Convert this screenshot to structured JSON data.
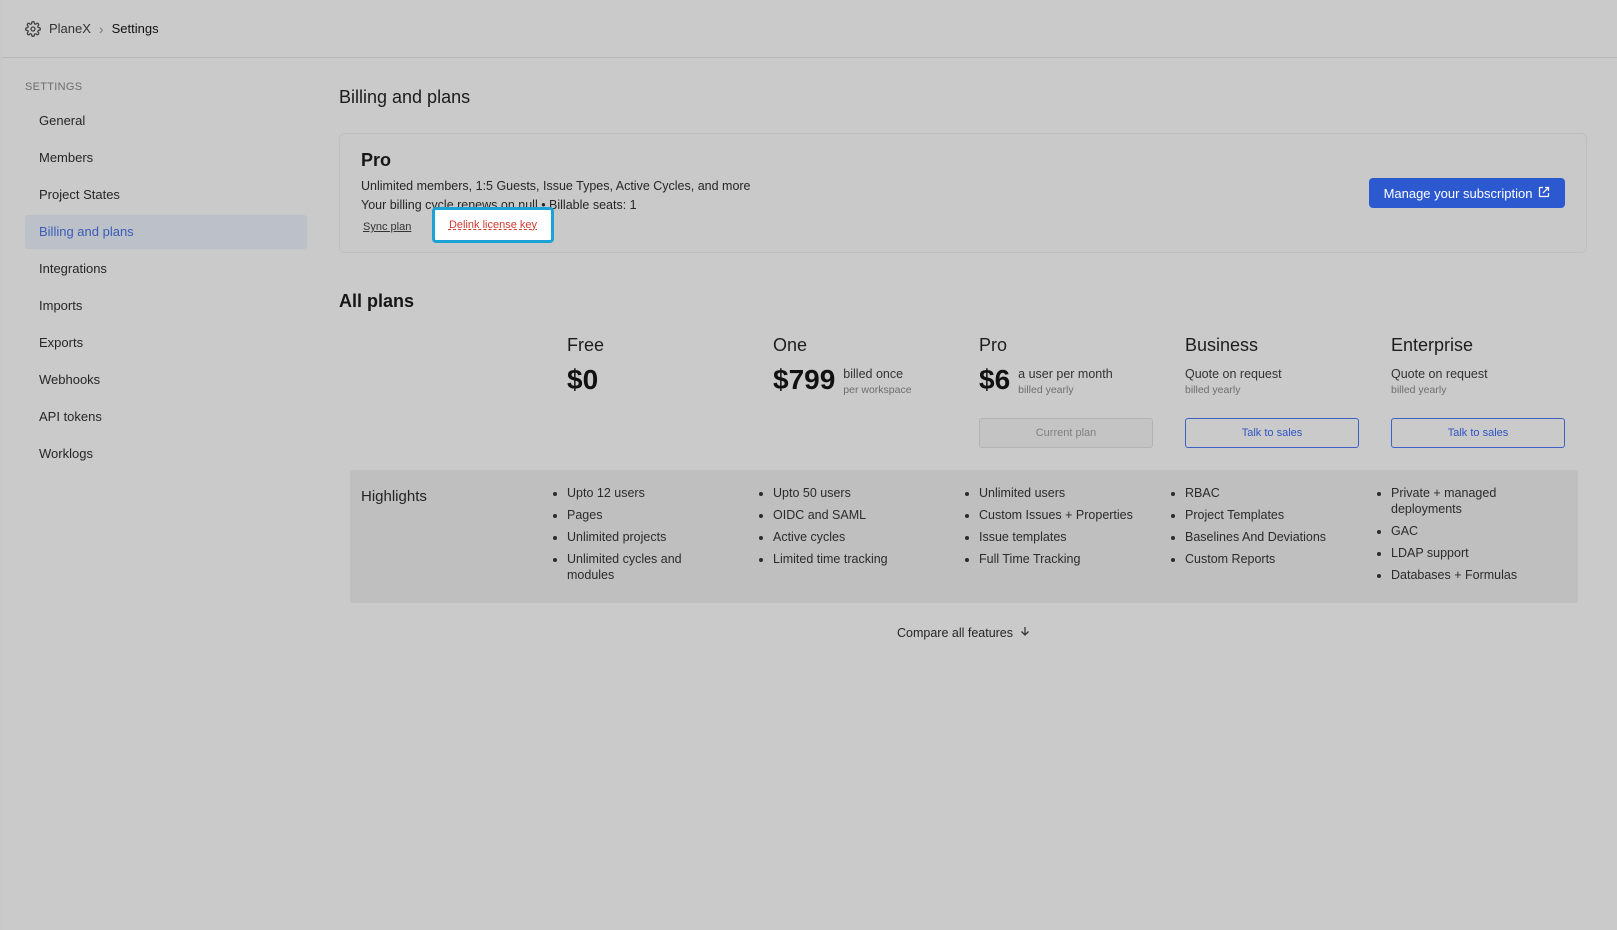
{
  "breadcrumb": {
    "workspace": "PlaneX",
    "page": "Settings"
  },
  "sidebar": {
    "section_label": "SETTINGS",
    "items": [
      {
        "label": "General"
      },
      {
        "label": "Members"
      },
      {
        "label": "Project States"
      },
      {
        "label": "Billing and plans",
        "active": true
      },
      {
        "label": "Integrations"
      },
      {
        "label": "Imports"
      },
      {
        "label": "Exports"
      },
      {
        "label": "Webhooks"
      },
      {
        "label": "API tokens"
      },
      {
        "label": "Worklogs"
      }
    ]
  },
  "main": {
    "title": "Billing and plans",
    "current_plan": {
      "name": "Pro",
      "description": "Unlimited members, 1:5 Guests, Issue Types, Active Cycles, and more",
      "cycle": "Your billing cycle renews on null • Billable seats: 1",
      "sync_label": "Sync plan",
      "delink_label": "Delink license key",
      "manage_label": "Manage your subscription"
    },
    "all_plans_title": "All plans",
    "plans": [
      {
        "name": "Free",
        "price": "$0"
      },
      {
        "name": "One",
        "price": "$799",
        "price_main": "billed once",
        "price_sub": "per workspace"
      },
      {
        "name": "Pro",
        "price": "$6",
        "price_main": "a user per month",
        "price_sub": "billed yearly",
        "button": "Current plan"
      },
      {
        "name": "Business",
        "quote": "Quote on request",
        "quote_sub": "billed yearly",
        "button": "Talk to sales"
      },
      {
        "name": "Enterprise",
        "quote": "Quote on request",
        "quote_sub": "billed yearly",
        "button": "Talk to sales"
      }
    ],
    "highlights_label": "Highlights",
    "highlights": [
      [
        "Upto 12 users",
        "Pages",
        "Unlimited projects",
        "Unlimited cycles and modules"
      ],
      [
        "Upto 50 users",
        "OIDC and SAML",
        "Active cycles",
        "Limited time tracking"
      ],
      [
        "Unlimited users",
        "Custom Issues + Properties",
        "Issue templates",
        "Full Time Tracking"
      ],
      [
        "RBAC",
        "Project Templates",
        "Baselines And Deviations",
        "Custom Reports"
      ],
      [
        "Private + managed deployments",
        "GAC",
        "LDAP support",
        "Databases + Formulas"
      ]
    ],
    "compare_label": "Compare all features"
  },
  "colors": {
    "accent": "#2c59d0",
    "active_nav_text": "#3a5bb8",
    "highlight_box": "#1da2d8",
    "danger_link": "#cc3b2f"
  }
}
